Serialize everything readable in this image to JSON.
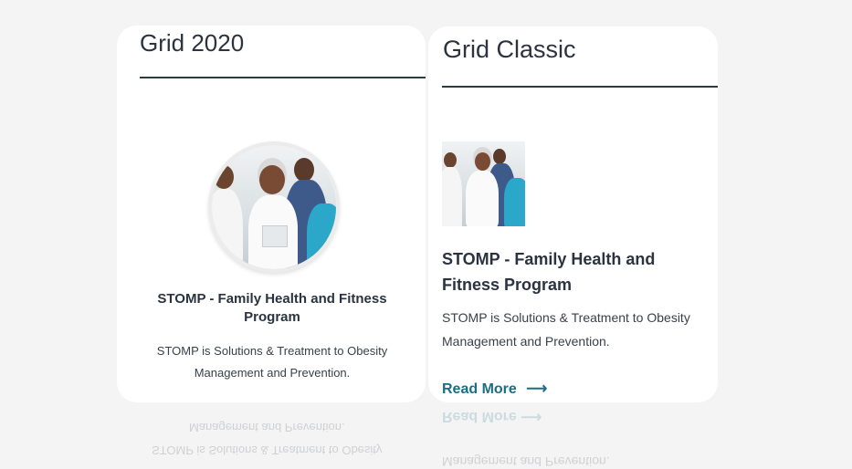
{
  "grid2020": {
    "title": "Grid 2020",
    "post_heading": "STOMP - Family Health and Fitness Program",
    "post_excerpt": "STOMP is Solutions & Treatment to Obesity Management and Prevention.",
    "image_alt": "Group of medical professionals"
  },
  "gridClassic": {
    "title": "Grid Classic",
    "post_heading": "STOMP - Family Health and Fitness Program",
    "post_excerpt": "STOMP is Solutions & Treatment to Obesity Management and Prevention.",
    "read_more_label": "Read More",
    "read_more_arrow": "⟶",
    "image_alt": "Group of medical professionals"
  },
  "reflection": {
    "line1": "Management and Prevention.",
    "line2": "STOMP is Solutions & Treatment to Obesity",
    "read_more": "Read More ⟶",
    "line3": "Management and Prevention."
  },
  "colors": {
    "page_bg": "#f4f4f4",
    "card_bg": "#ffffff",
    "text": "#2b3340",
    "link": "#1c6e86"
  }
}
